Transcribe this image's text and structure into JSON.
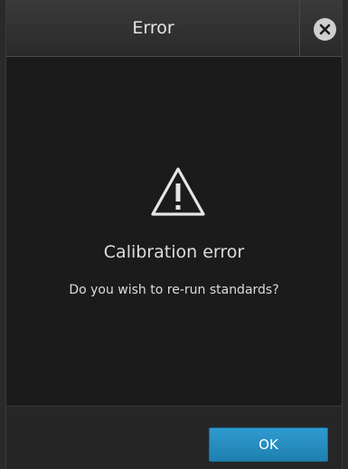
{
  "header": {
    "title": "Error",
    "close_icon": "close-circle-icon"
  },
  "message": {
    "icon": "warning-triangle-icon",
    "title": "Calibration error",
    "text": "Do you wish to re-run standards?"
  },
  "footer": {
    "ok_label": "OK"
  },
  "colors": {
    "accent": "#2a8fc4",
    "background": "#1b1b1b",
    "text": "#dcdcdc"
  }
}
